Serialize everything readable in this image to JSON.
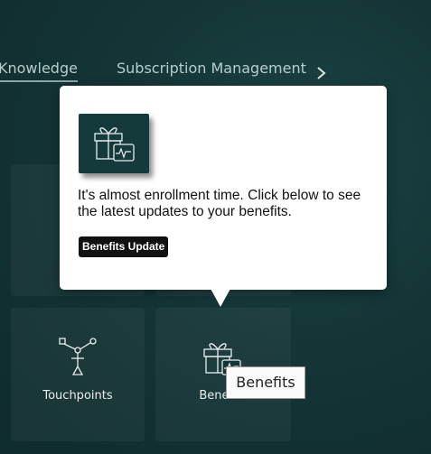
{
  "nav": {
    "items": [
      {
        "label": "Knowledge"
      },
      {
        "label": "Subscription Management"
      }
    ],
    "next_icon": "chevron-right-icon"
  },
  "tiles": [
    {
      "label": "Touchpoints",
      "icon": "touchpoints-icon"
    },
    {
      "label": "Benefits",
      "icon": "gift-icon"
    }
  ],
  "popover": {
    "icon": "gift-pulse-icon",
    "message": "It's almost enrollment time. Click below to see the latest updates to your benefits.",
    "button_label": "Benefits Update"
  },
  "tooltip": {
    "text": "Benefits"
  },
  "colors": {
    "background": "#143536",
    "popover_bg": "#ffffff",
    "button_bg": "#111111",
    "icon_box_bg": "#143a3c"
  }
}
